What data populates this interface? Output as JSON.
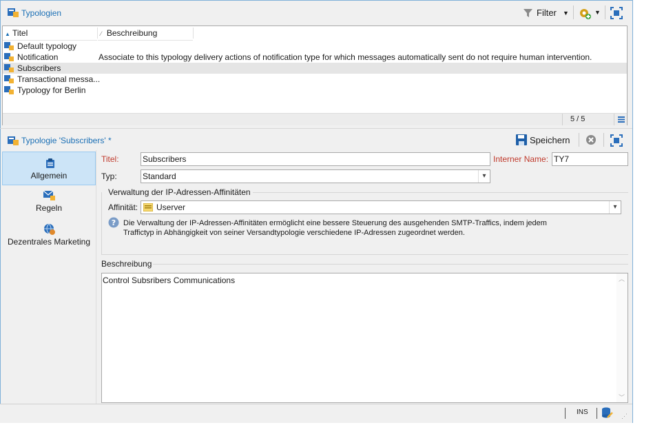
{
  "list_panel": {
    "title": "Typologien",
    "filter_label": "Filter",
    "columns": [
      "Titel",
      "Beschreibung"
    ],
    "rows": [
      {
        "title": "Default typology",
        "description": ""
      },
      {
        "title": "Notification",
        "description": "Associate to this typology delivery actions of notification type for which messages automatically sent do not require human intervention."
      },
      {
        "title": "Subscribers",
        "description": ""
      },
      {
        "title": "Transactional messa...",
        "description": ""
      },
      {
        "title": "Typology for Berlin",
        "description": ""
      }
    ],
    "count": "5 / 5"
  },
  "detail_panel": {
    "title": "Typologie 'Subscribers' *",
    "save_label": "Speichern",
    "nav": [
      {
        "label": "Allgemein",
        "icon": "clipboard-icon"
      },
      {
        "label": "Regeln",
        "icon": "envelope-rules-icon"
      },
      {
        "label": "Dezentrales Marketing",
        "icon": "globe-icon"
      }
    ],
    "form": {
      "title_label": "Titel:",
      "title_value": "Subscribers",
      "internal_name_label": "Interner Name:",
      "internal_name_value": "TY7",
      "type_label": "Typ:",
      "type_value": "Standard",
      "ip_group_label": "Verwaltung der IP-Adressen-Affinitäten",
      "affinity_label": "Affinität:",
      "affinity_value": "Userver",
      "help_text_line1": "Die Verwaltung der IP-Adressen-Affinitäten ermöglicht eine bessere Steuerung des ausgehenden SMTP-Traffics, indem jedem",
      "help_text_line2": "Traffictyp in Abhängigkeit von seiner Versandtypologie verschiedene IP-Adressen zugeordnet werden.",
      "description_label": "Beschreibung",
      "description_value": "Control Subsribers Communications"
    }
  },
  "status_bar": {
    "mode": "INS"
  },
  "colors": {
    "accent": "#1a6fb5",
    "required": "#c0392b",
    "selection": "#cce4f7"
  }
}
